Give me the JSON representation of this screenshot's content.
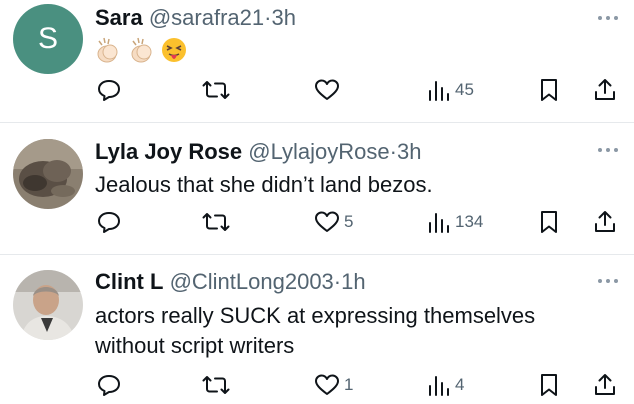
{
  "tweets": [
    {
      "avatar_letter": "S",
      "name": "Sara",
      "handle": "@sarafra21",
      "dot": "·",
      "time": "3h",
      "text": "",
      "emojis": [
        "clapping-hands-emoji",
        "clapping-hands-emoji",
        "squinting-tongue-face-emoji"
      ],
      "replies": "",
      "retweets": "",
      "likes": "",
      "views": "45"
    },
    {
      "avatar_letter": "",
      "name": "Lyla Joy Rose",
      "handle": "@LylajoyRose",
      "dot": "·",
      "time": "3h",
      "text": "Jealous that she didn’t land bezos.",
      "replies": "",
      "retweets": "",
      "likes": "5",
      "views": "134"
    },
    {
      "avatar_letter": "",
      "name": "Clint L",
      "handle": "@ClintLong2003",
      "dot": "·",
      "time": "1h",
      "text_line1": "actors really SUCK at expressing themselves",
      "text_line2": "without script writers",
      "replies": "",
      "retweets": "",
      "likes": "1",
      "views": "4"
    }
  ],
  "colors": {
    "icon_gray": "#536471",
    "text": "#0f1419",
    "avatar_green": "#4a9080",
    "divider": "#e6e9ec"
  },
  "icons": [
    "reply-icon",
    "retweet-icon",
    "like-icon",
    "views-icon",
    "bookmark-icon",
    "share-icon",
    "more-icon"
  ]
}
